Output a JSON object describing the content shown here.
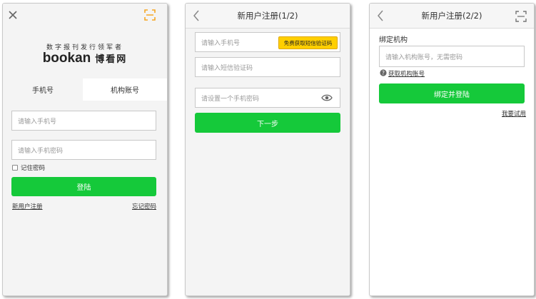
{
  "login": {
    "tagline": "数字报刊发行领军者",
    "brand_en": "bookan",
    "brand_cn": "博看网",
    "tabs": [
      "手机号",
      "机构账号"
    ],
    "phone_placeholder": "请输入手机号",
    "password_placeholder": "请输入手机密码",
    "remember_label": "记住密码",
    "login_button": "登陆",
    "register_link": "新用户注册",
    "forgot_link": "忘记密码"
  },
  "register1": {
    "title": "新用户注册(1/2)",
    "phone_placeholder": "请输入手机号",
    "sms_button": "免费获取短信验证码",
    "code_placeholder": "请输入短信验证码",
    "password_placeholder": "请设置一个手机密码",
    "next_button": "下一步"
  },
  "register2": {
    "title": "新用户注册(2/2)",
    "section_label": "绑定机构",
    "org_placeholder": "请输入机构账号，无需密码",
    "help_link": "获取机构账号",
    "bind_button": "绑定并登陆",
    "trial_link": "我要试用"
  },
  "colors": {
    "green": "#15c93a",
    "accent_orange": "#f5a623",
    "sms_yellow": "#ffcf00"
  }
}
